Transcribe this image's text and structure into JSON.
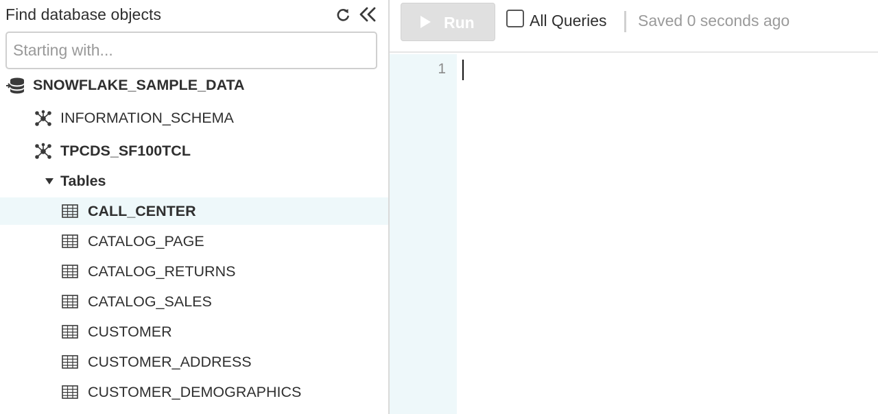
{
  "sidebar": {
    "title": "Find database objects",
    "refresh_icon": "refresh-icon",
    "collapse_icon": "double-chevron-left-icon",
    "search": {
      "placeholder": "Starting with...",
      "value": ""
    },
    "tree": {
      "database": {
        "label": "SNOWFLAKE_SAMPLE_DATA",
        "icon": "database-icon"
      },
      "schemas": [
        {
          "label": "INFORMATION_SCHEMA",
          "icon": "schema-icon"
        },
        {
          "label": "TPCDS_SF100TCL",
          "icon": "schema-icon"
        }
      ],
      "tables_folder": {
        "label": "Tables",
        "expanded": true
      },
      "tables": [
        {
          "label": "CALL_CENTER",
          "selected": true
        },
        {
          "label": "CATALOG_PAGE"
        },
        {
          "label": "CATALOG_RETURNS"
        },
        {
          "label": "CATALOG_SALES"
        },
        {
          "label": "CUSTOMER"
        },
        {
          "label": "CUSTOMER_ADDRESS"
        },
        {
          "label": "CUSTOMER_DEMOGRAPHICS"
        }
      ]
    }
  },
  "toolbar": {
    "run_label": "Run",
    "run_enabled": false,
    "all_queries_label": "All Queries",
    "all_queries_checked": false,
    "saved_status": "Saved 0 seconds ago"
  },
  "editor": {
    "line_numbers": [
      "1"
    ],
    "content": ""
  },
  "colors": {
    "selected_row_bg": "#eef8fa",
    "gutter_bg": "#eef8fa",
    "run_button_bg": "#e0e0e0",
    "muted_text": "#9a9a9a"
  }
}
